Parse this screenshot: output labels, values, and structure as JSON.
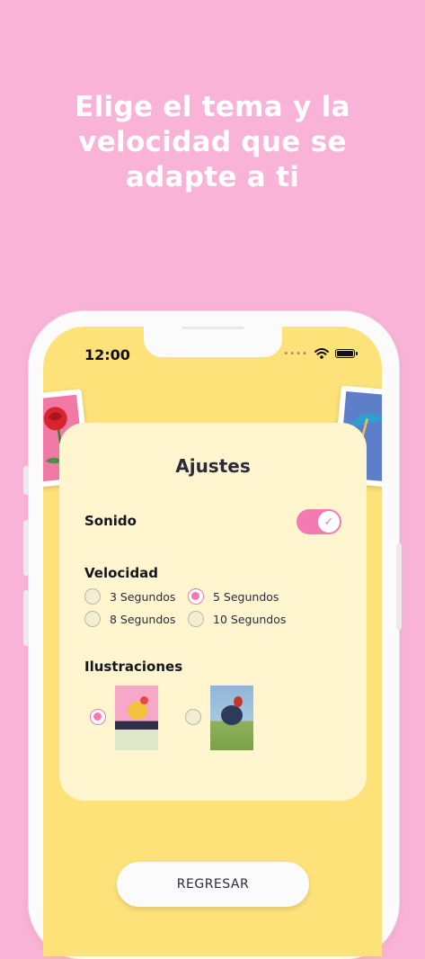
{
  "headline": {
    "line1": "Elige el tema y la",
    "line2": "velocidad que se",
    "line3": "adapte a ti"
  },
  "status_bar": {
    "time": "12:00",
    "signal_icon": "signal-dots-icon",
    "wifi_icon": "wifi-icon",
    "battery_icon": "battery-icon"
  },
  "settings": {
    "title": "Ajustes",
    "sound": {
      "label": "Sonido",
      "enabled": true
    },
    "speed": {
      "label": "Velocidad",
      "options": [
        "3 Segundos",
        "5 Segundos",
        "8 Segundos",
        "10 Segundos"
      ],
      "selected": "5 Segundos"
    },
    "illustrations": {
      "label": "Ilustraciones",
      "selected_index": 0
    }
  },
  "back_button": {
    "label": "REGRESAR"
  },
  "colors": {
    "background": "#f9b3d6",
    "screen": "#fde27a",
    "panel": "#fff6cf",
    "accent": "#f27ab0"
  }
}
